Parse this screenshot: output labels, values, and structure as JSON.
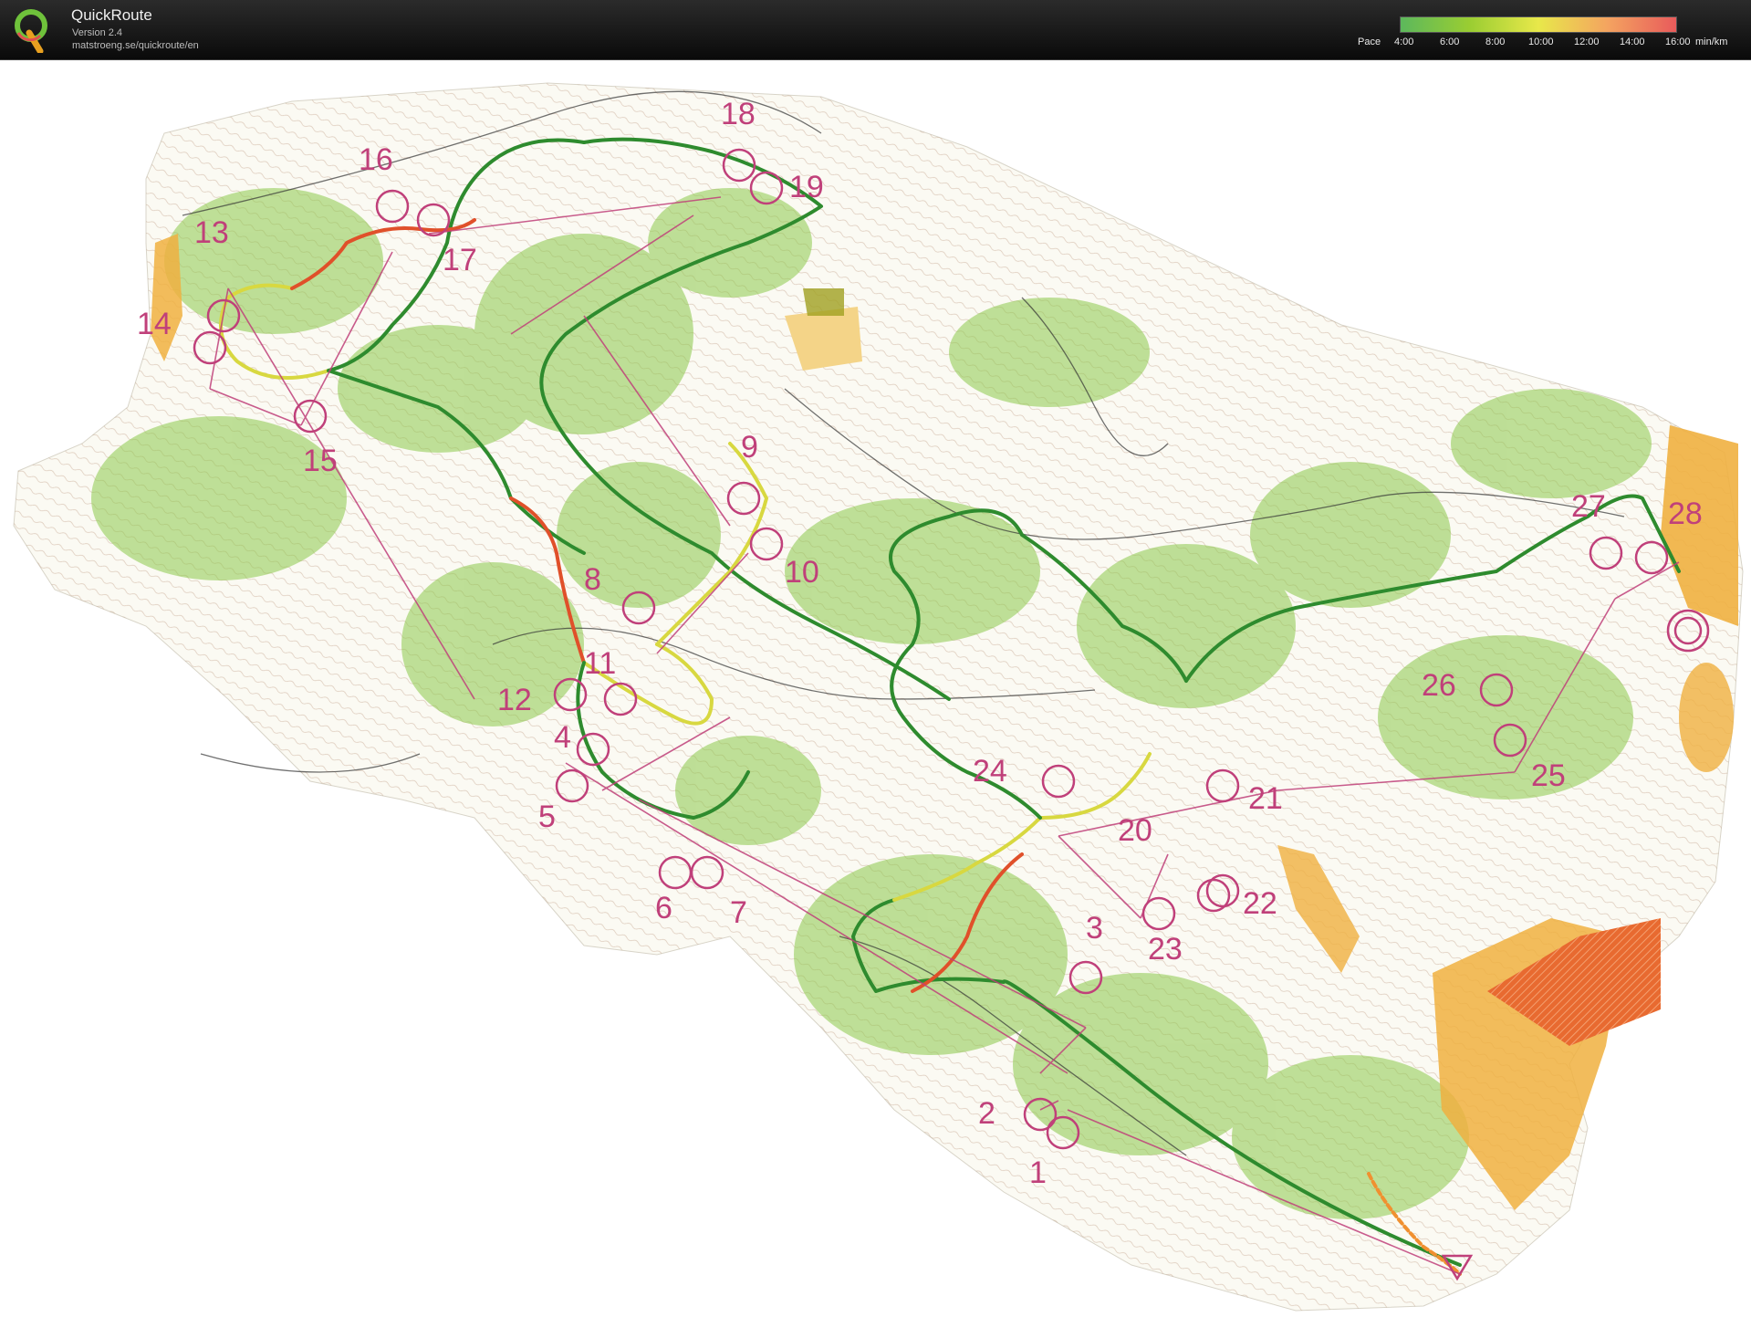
{
  "app": {
    "title": "QuickRoute",
    "version": "Version 2.4",
    "url": "matstroeng.se/quickroute/en"
  },
  "pace_legend": {
    "label": "Pace",
    "ticks": [
      "4:00",
      "6:00",
      "8:00",
      "10:00",
      "12:00",
      "14:00",
      "16:00"
    ],
    "unit": "min/km",
    "colors": [
      "#5cb85c",
      "#9acd32",
      "#e8e84a",
      "#f4a460",
      "#e85b5b"
    ]
  },
  "map": {
    "controls": [
      {
        "label": "1"
      },
      {
        "label": "2"
      },
      {
        "label": "3"
      },
      {
        "label": "4"
      },
      {
        "label": "5"
      },
      {
        "label": "6"
      },
      {
        "label": "7"
      },
      {
        "label": "8"
      },
      {
        "label": "9"
      },
      {
        "label": "10"
      },
      {
        "label": "11"
      },
      {
        "label": "12"
      },
      {
        "label": "13"
      },
      {
        "label": "14"
      },
      {
        "label": "15"
      },
      {
        "label": "16"
      },
      {
        "label": "17"
      },
      {
        "label": "18"
      },
      {
        "label": "19"
      },
      {
        "label": "20"
      },
      {
        "label": "21"
      },
      {
        "label": "22"
      },
      {
        "label": "23"
      },
      {
        "label": "24"
      },
      {
        "label": "25"
      },
      {
        "label": "26"
      },
      {
        "label": "27"
      },
      {
        "label": "28"
      }
    ],
    "colors": {
      "course": "#c0407a",
      "route_fast": "#2e8b2e",
      "route_mid": "#d8d840",
      "route_slow": "#e0502a",
      "vegetation": "#8cc84b",
      "open_land": "#f0b040",
      "contour": "#9a6a4a"
    }
  }
}
